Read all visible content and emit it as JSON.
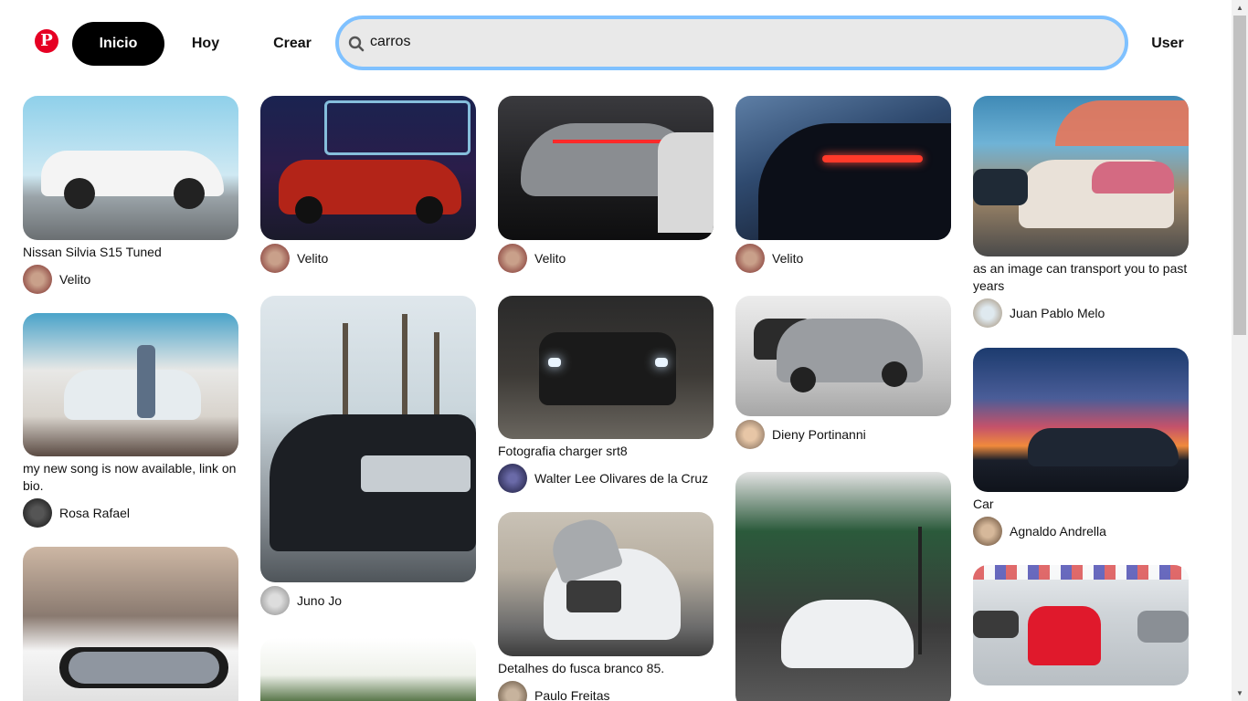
{
  "header": {
    "home_label": "Inicio",
    "today_label": "Hoy",
    "create_label": "Crear",
    "search_value": "carros",
    "user_label": "User"
  },
  "pins": [
    {
      "title": "Nissan Silvia S15 Tuned",
      "author": "Velito"
    },
    {
      "title": "my new song is now available, link on bio.",
      "author": "Rosa Rafael"
    },
    {
      "title": "",
      "author": ""
    },
    {
      "title": "",
      "author": "Velito"
    },
    {
      "title": "",
      "author": "Juno Jo"
    },
    {
      "title": "",
      "author": ""
    },
    {
      "title": "",
      "author": "Velito"
    },
    {
      "title": "Fotografia charger srt8",
      "author": "Walter Lee Olivares de la Cruz"
    },
    {
      "title": "Detalhes do fusca branco 85.",
      "author": "Paulo Freitas"
    },
    {
      "title": "",
      "author": "Velito"
    },
    {
      "title": "",
      "author": "Dieny Portinanni"
    },
    {
      "title": "",
      "author": ""
    },
    {
      "title": "as an image can transport you to past years",
      "author": "Juan Pablo Melo"
    },
    {
      "title": "Car",
      "author": "Agnaldo Andrella"
    },
    {
      "title": "",
      "author": ""
    }
  ]
}
